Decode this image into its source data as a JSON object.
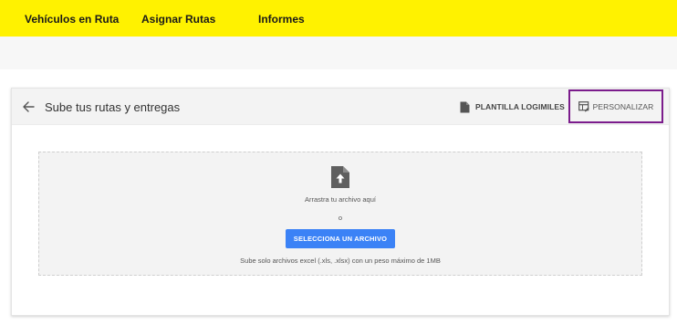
{
  "topnav": {
    "items": [
      {
        "label": "Vehículos en Ruta"
      },
      {
        "label": "Asignar Rutas"
      },
      {
        "label": "Informes"
      }
    ],
    "background_color": "#fff200"
  },
  "card": {
    "title": "Sube tus rutas y entregas",
    "back_icon": "arrow-left-icon",
    "actions": {
      "template_label": "PLANTILLA LOGIMILES",
      "template_icon": "document-icon",
      "customize_label": "PERSONALIZAR",
      "customize_icon": "table-edit-icon",
      "customize_highlight_color": "#7b1c8c"
    }
  },
  "dropzone": {
    "icon": "file-upload-icon",
    "drag_text": "Arrastra tu archivo aquí",
    "or_text": "o",
    "select_button_label": "SELECCIONA UN ARCHIVO",
    "select_button_color": "#3b82f6",
    "hint_text": "Sube solo archivos excel (.xls, .xlsx) con un peso máximo de 1MB"
  }
}
